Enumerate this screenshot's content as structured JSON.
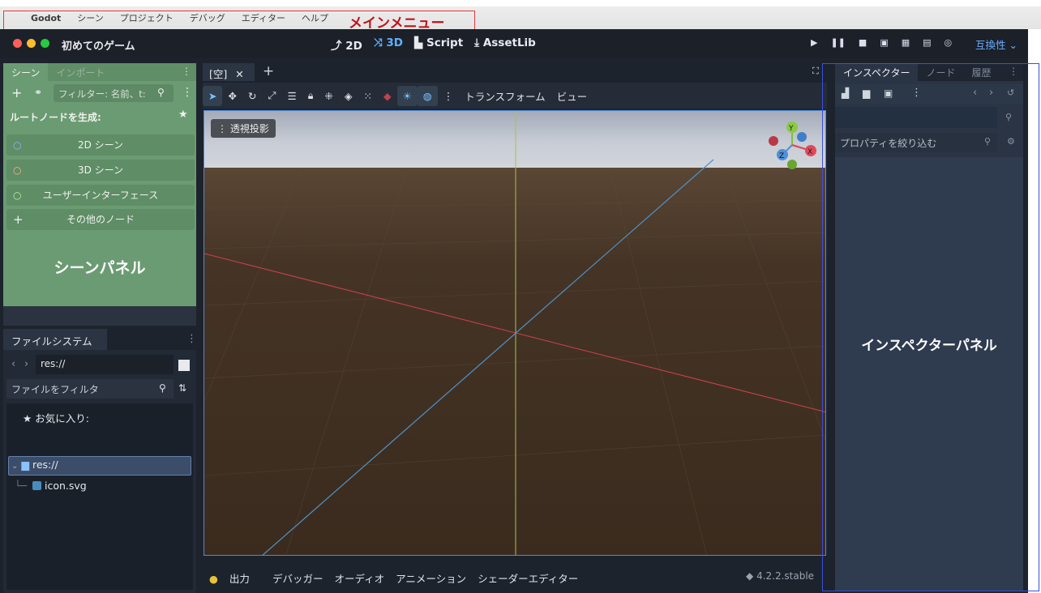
{
  "mac_menu": {
    "apple": "",
    "app": "Godot",
    "items": [
      "シーン",
      "プロジェクト",
      "デバッグ",
      "エディター",
      "ヘルプ"
    ]
  },
  "annotations": {
    "main_menu": "メインメニュー",
    "scene_panel": "シーンパネル",
    "inspector_panel": "インスペクターパネル"
  },
  "titlebar": {
    "project_name": "初めてのゲーム",
    "workspaces": [
      "2D",
      "3D",
      "Script",
      "AssetLib"
    ],
    "active_workspace": "3D",
    "compat": "互換性"
  },
  "scene_panel": {
    "tabs": [
      "シーン",
      "インポート"
    ],
    "filter_placeholder": "フィルター: 名前、t:",
    "root_label": "ルートノードを生成:",
    "buttons": [
      "2D シーン",
      "3D シーン",
      "ユーザーインターフェース",
      "その他のノード"
    ]
  },
  "filesystem": {
    "tab": "ファイルシステム",
    "path": "res://",
    "filter_placeholder": "ファイルをフィルタ",
    "favorites": "お気に入り:",
    "root": "res://",
    "file": "icon.svg"
  },
  "viewport": {
    "tab": "[空]",
    "toolbar_menus": [
      "トランスフォーム",
      "ビュー"
    ],
    "perspective": "透視投影",
    "gizmo": {
      "y": "Y",
      "x": "X",
      "z": "Z"
    }
  },
  "bottom_panel": {
    "tabs": [
      "出力",
      "デバッガー",
      "オーディオ",
      "アニメーション",
      "シェーダーエディター"
    ],
    "version": "4.2.2.stable"
  },
  "inspector": {
    "tabs": [
      "インスペクター",
      "ノード",
      "履歴"
    ],
    "filter_placeholder": "プロパティを絞り込む"
  },
  "colors": {
    "scene_panel": "#6b9b73",
    "inspector_outline": "#3a4fe0",
    "menu_outline": "#e23a3a",
    "accent": "#5fb1ff"
  }
}
